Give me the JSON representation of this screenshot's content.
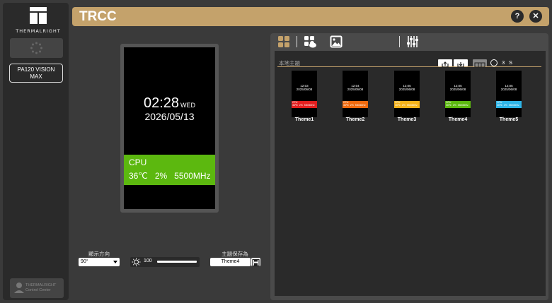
{
  "sidebar": {
    "brand": "THERMALRIGHT",
    "device_label": "PA120 VISION\nMAX",
    "control_center": {
      "line1": "THERMALRIGHT",
      "line2": "Control Center"
    }
  },
  "header": {
    "title": "TRCC",
    "help_label": "?",
    "close_label": "✕",
    "accent_color": "#c4a26b"
  },
  "preview": {
    "time": "02:28",
    "weekday": "WED",
    "date": "2026/05/13",
    "cpu_label": "CPU",
    "cpu_values": "36℃   2%   5500MHz",
    "bar_color": "#5cb80f"
  },
  "controls": {
    "orientation_label": "顯示方向",
    "orientation_value": "90°",
    "brightness_value": "100",
    "save_label": "主題保存為",
    "save_value": "Theme4"
  },
  "themes_panel": {
    "tab_icons": [
      "grid-icon",
      "cloud-themes-icon",
      "image-icon",
      "sliders-icon"
    ],
    "section_label": "本地主題",
    "interval_value": "3",
    "interval_unit": "S",
    "themes": [
      {
        "name": "Theme1",
        "time": "12:03",
        "date": "2025/06/08",
        "color": "#e21f1f"
      },
      {
        "name": "Theme2",
        "time": "12:04",
        "date": "2025/06/08",
        "color": "#f06a0e"
      },
      {
        "name": "Theme3",
        "time": "12:05",
        "date": "2025/06/08",
        "color": "#f4b21a"
      },
      {
        "name": "Theme4",
        "time": "12:05",
        "date": "2025/06/08",
        "color": "#5cb80f"
      },
      {
        "name": "Theme5",
        "time": "12:05",
        "date": "2025/06/08",
        "color": "#2eb5e8"
      }
    ],
    "theme_bar_text": "CPU\n36℃  2%  5500MHz"
  }
}
